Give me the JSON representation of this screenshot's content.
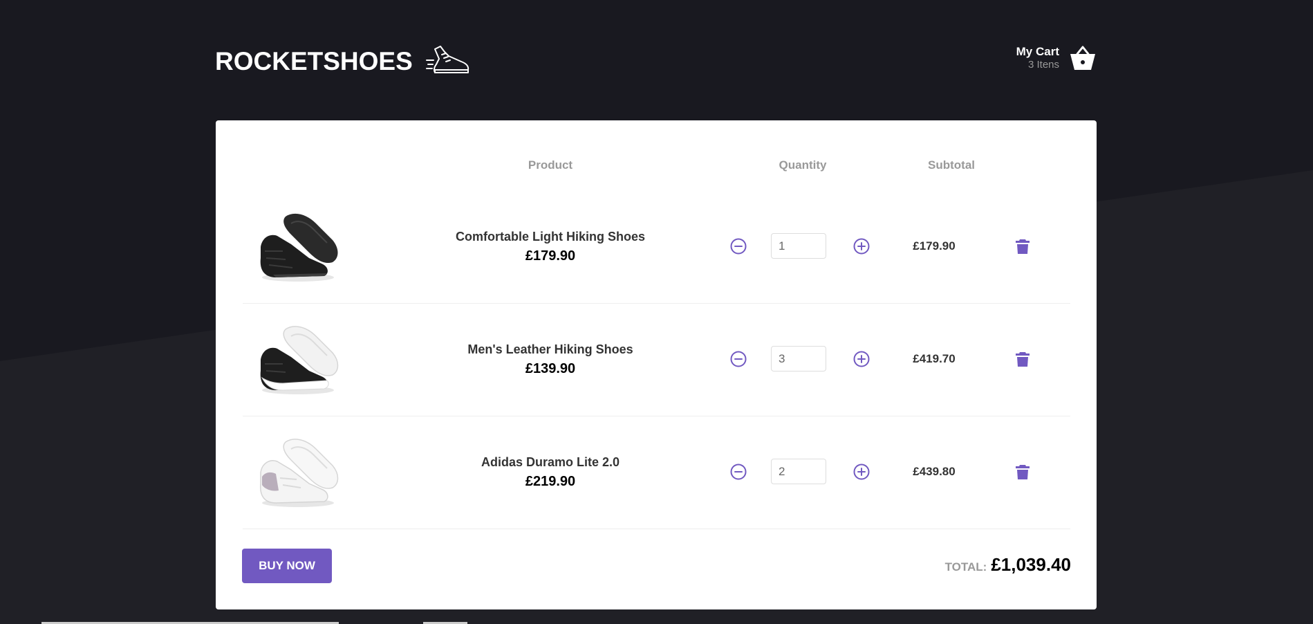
{
  "brand": {
    "name": "ROCKETSHOES",
    "icon": "running-shoe-icon"
  },
  "cart": {
    "title": "My Cart",
    "count_text": "3 Itens",
    "icon": "basket-icon"
  },
  "table": {
    "headers": {
      "product": "Product",
      "quantity": "Quantity",
      "subtotal": "Subtotal"
    },
    "rows": [
      {
        "title": "Comfortable Light Hiking Shoes",
        "price": "£179.90",
        "quantity": "1",
        "subtotal": "£179.90",
        "image": "black-sneaker"
      },
      {
        "title": "Men's Leather Hiking Shoes",
        "price": "£139.90",
        "quantity": "3",
        "subtotal": "£419.70",
        "image": "black-white-sneaker"
      },
      {
        "title": "Adidas Duramo Lite 2.0",
        "price": "£219.90",
        "quantity": "2",
        "subtotal": "£439.80",
        "image": "white-sneaker"
      }
    ]
  },
  "footer": {
    "buy_label": "BUY NOW",
    "total_label": "TOTAL:",
    "total_value": "£1,039.40"
  },
  "colors": {
    "background": "#191920",
    "accent": "#7159c1",
    "panel": "#ffffff"
  }
}
